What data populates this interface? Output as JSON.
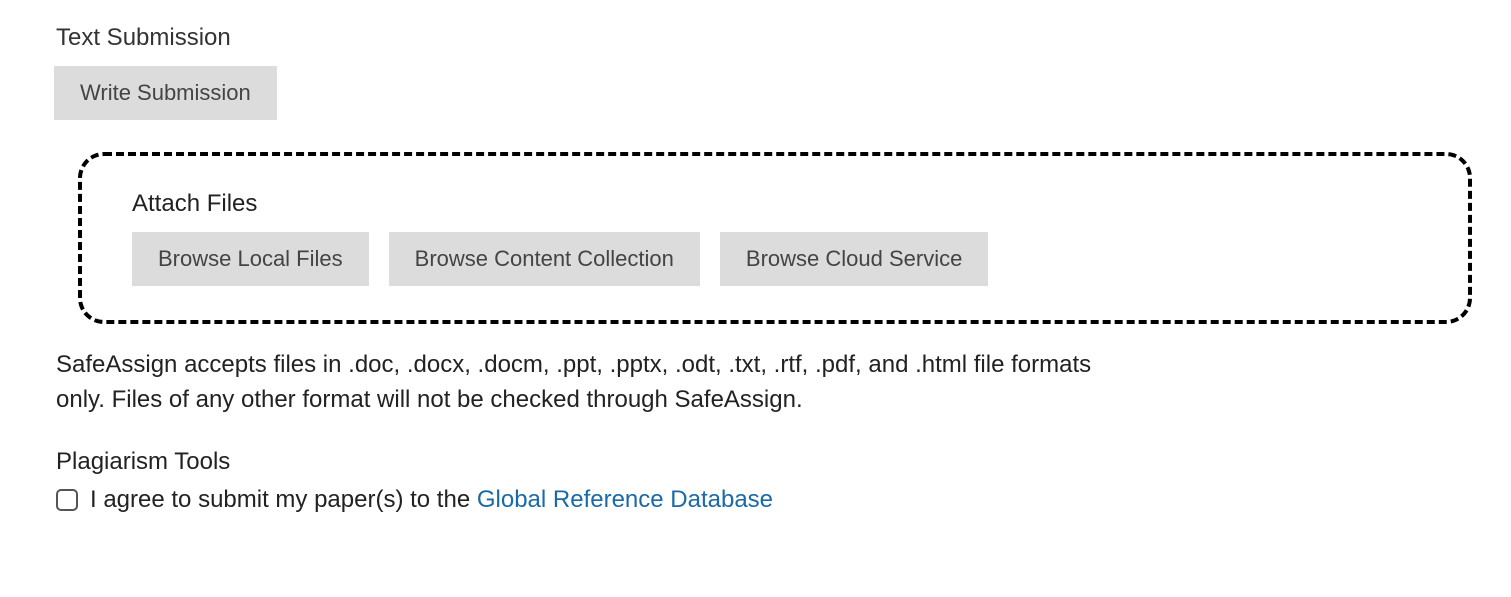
{
  "text_submission": {
    "label": "Text Submission",
    "write_btn": "Write Submission"
  },
  "attach_files": {
    "label": "Attach Files",
    "browse_local": "Browse Local Files",
    "browse_content": "Browse Content Collection",
    "browse_cloud": "Browse Cloud Service"
  },
  "safeassign_note": "SafeAssign accepts files in .doc, .docx, .docm, .ppt, .pptx, .odt, .txt, .rtf, .pdf, and .html file formats only. Files of any other format will not be checked through SafeAssign.",
  "plagiarism": {
    "label": "Plagiarism Tools",
    "consent_prefix": "I agree to submit my paper(s) to the ",
    "consent_link": "Global Reference Database"
  }
}
